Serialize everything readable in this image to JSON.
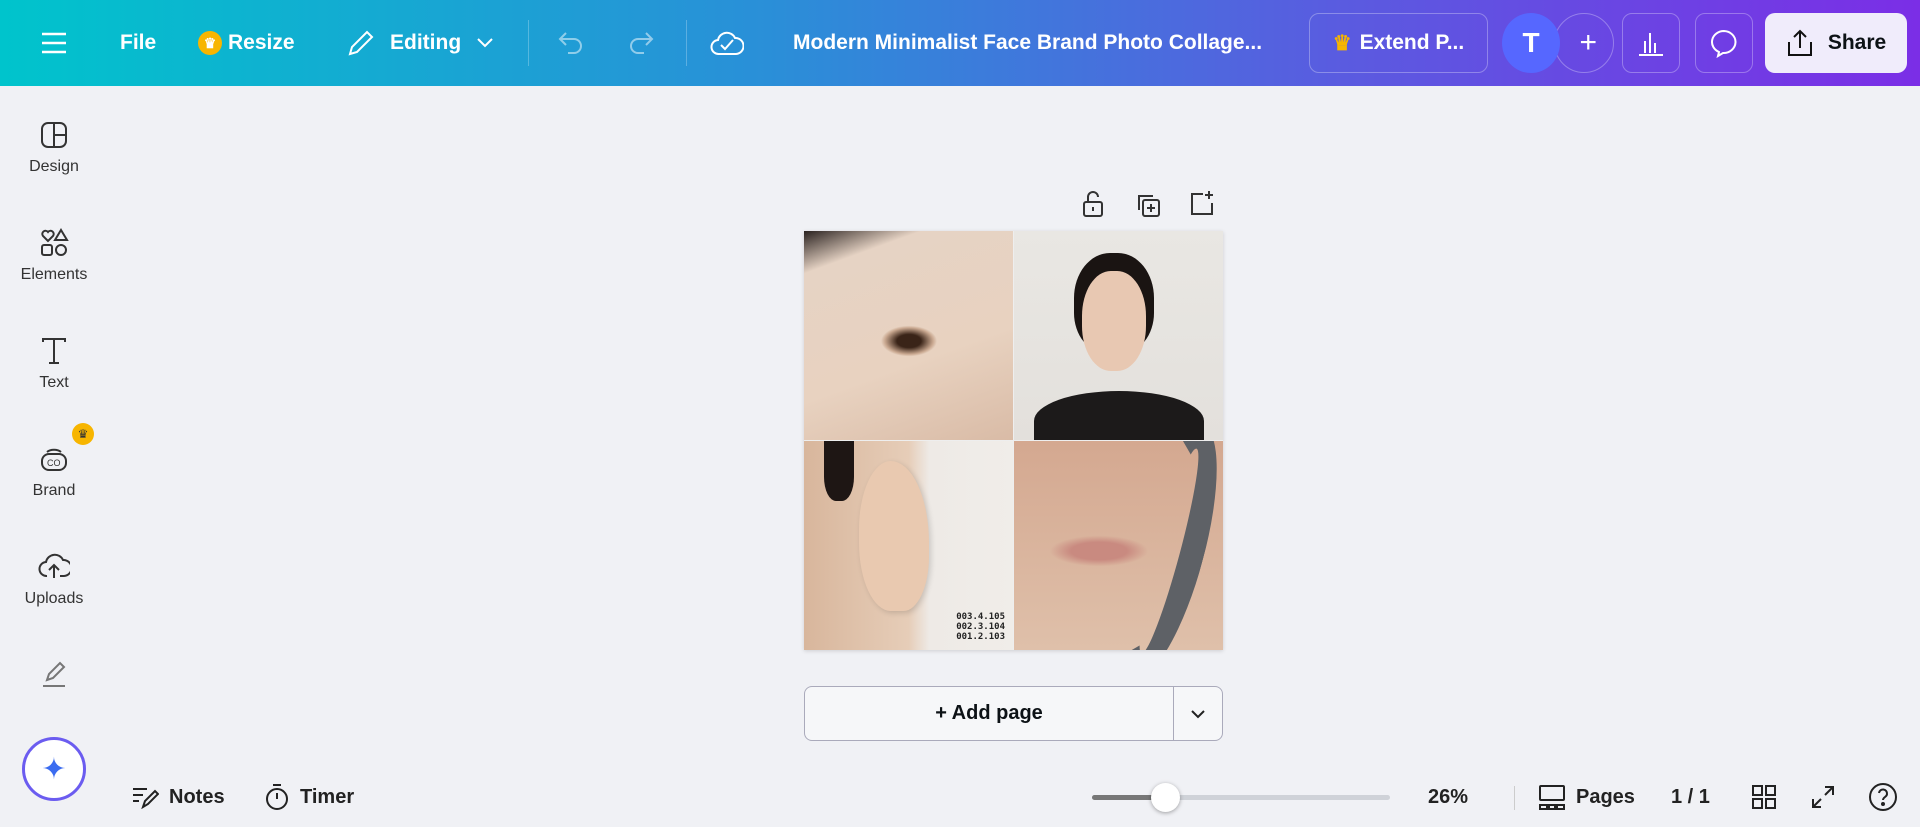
{
  "topbar": {
    "file": "File",
    "resize": "Resize",
    "editing": "Editing",
    "title": "Modern Minimalist Face Brand Photo Collage...",
    "extend": "Extend P...",
    "avatar": "T",
    "share": "Share"
  },
  "sidebar": {
    "items": [
      {
        "label": "Design"
      },
      {
        "label": "Elements"
      },
      {
        "label": "Text"
      },
      {
        "label": "Brand"
      },
      {
        "label": "Uploads"
      }
    ]
  },
  "canvas": {
    "codes": [
      "003.4.105",
      "002.3.104",
      "001.2.103"
    ],
    "add_page": "+ Add page"
  },
  "bottombar": {
    "notes": "Notes",
    "timer": "Timer",
    "zoom": "26%",
    "zoom_value": 26,
    "pages": "Pages",
    "page_count": "1 / 1"
  },
  "colors": {
    "accent": "#8b3dff",
    "crown": "#f7b500",
    "avatar": "#5667ff"
  }
}
